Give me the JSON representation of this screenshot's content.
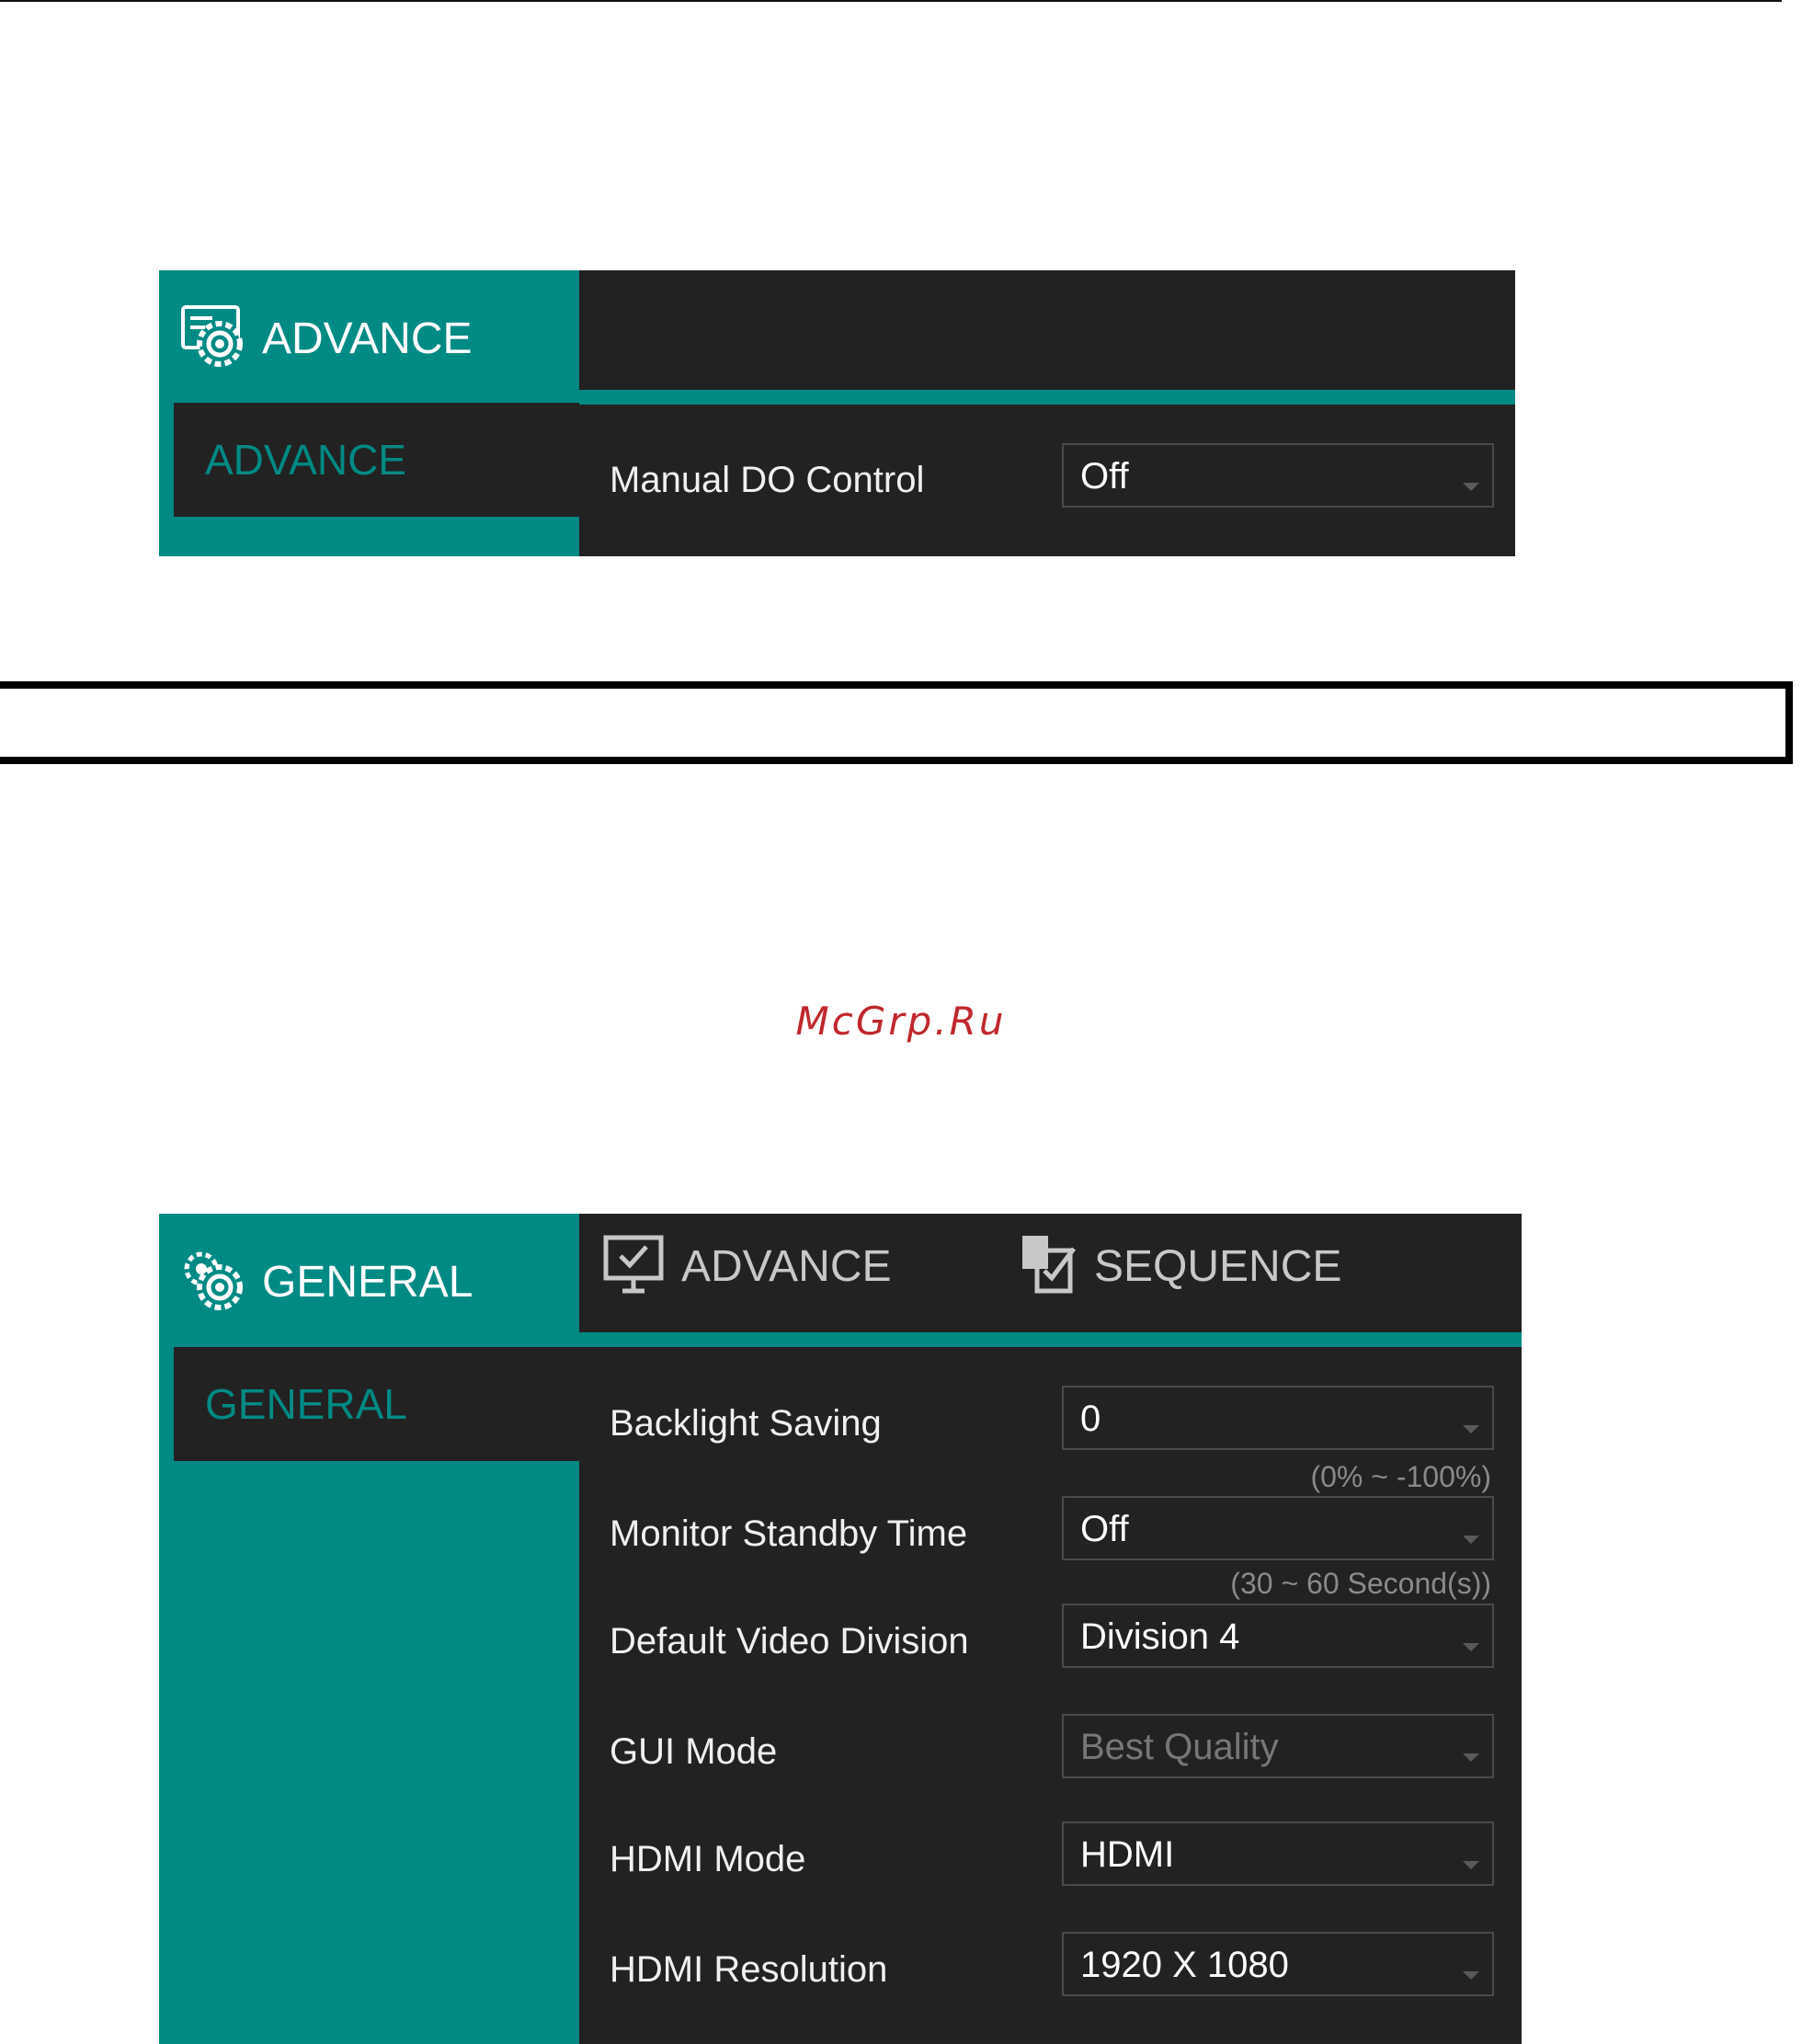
{
  "watermark": "McGrp.Ru",
  "top_panel": {
    "side_title": "ADVANCE",
    "side_item": "ADVANCE",
    "rows": [
      {
        "label": "Manual DO Control",
        "value": "Off"
      }
    ]
  },
  "bottom_panel": {
    "side_title": "GENERAL",
    "side_item": "GENERAL",
    "tabs": [
      {
        "label": "ADVANCE",
        "icon": "monitor-check-icon"
      },
      {
        "label": "SEQUENCE",
        "icon": "sequence-icon"
      }
    ],
    "rows": [
      {
        "label": "Backlight Saving",
        "value": "0",
        "hint": "(0% ~ -100%)"
      },
      {
        "label": "Monitor Standby Time",
        "value": "Off",
        "hint": "(30 ~ 60 Second(s))"
      },
      {
        "label": "Default Video Division",
        "value": "Division 4"
      },
      {
        "label": "GUI Mode",
        "value": "Best Quality",
        "disabled": true
      },
      {
        "label": "HDMI Mode",
        "value": "HDMI"
      },
      {
        "label": "HDMI Resolution",
        "value": "1920 X 1080"
      }
    ]
  },
  "colors": {
    "accent": "#008a84",
    "panel": "#222222",
    "watermark": "#c0282d"
  }
}
